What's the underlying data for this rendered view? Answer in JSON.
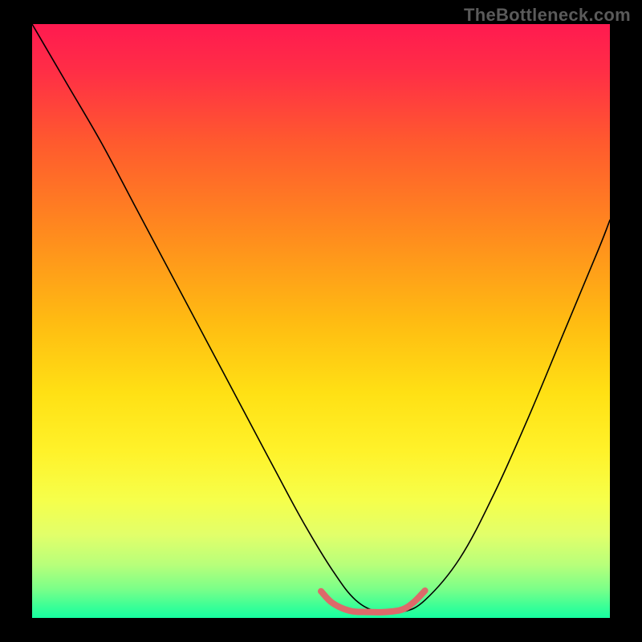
{
  "watermark": "TheBottleneck.com",
  "chart_data": {
    "type": "line",
    "title": "",
    "xlabel": "",
    "ylabel": "",
    "xlim": [
      0,
      100
    ],
    "ylim": [
      0,
      100
    ],
    "grid": false,
    "legend": false,
    "background_gradient": {
      "stops": [
        {
          "offset": 0.0,
          "color": "#ff1a50"
        },
        {
          "offset": 0.08,
          "color": "#ff2e46"
        },
        {
          "offset": 0.2,
          "color": "#ff5a2e"
        },
        {
          "offset": 0.35,
          "color": "#ff8a1e"
        },
        {
          "offset": 0.5,
          "color": "#ffbb12"
        },
        {
          "offset": 0.62,
          "color": "#ffe014"
        },
        {
          "offset": 0.72,
          "color": "#fff22a"
        },
        {
          "offset": 0.8,
          "color": "#f6ff4a"
        },
        {
          "offset": 0.86,
          "color": "#e2ff6a"
        },
        {
          "offset": 0.91,
          "color": "#b8ff7a"
        },
        {
          "offset": 0.95,
          "color": "#7dff88"
        },
        {
          "offset": 0.98,
          "color": "#3cff96"
        },
        {
          "offset": 1.0,
          "color": "#16ffa0"
        }
      ]
    },
    "series": [
      {
        "name": "bottleneck-curve",
        "color": "#000000",
        "width": 1.6,
        "x": [
          0,
          6,
          12,
          18,
          24,
          30,
          36,
          42,
          47,
          52,
          56,
          60,
          64,
          68,
          74,
          80,
          86,
          92,
          98,
          100
        ],
        "y": [
          100,
          90,
          80,
          69,
          58,
          47,
          36,
          25,
          16,
          8,
          3,
          1,
          1,
          3,
          10,
          21,
          34,
          48,
          62,
          67
        ]
      },
      {
        "name": "optimal-band-marker",
        "color": "#dd6a6a",
        "width": 8,
        "x": [
          50,
          52,
          55,
          58,
          61,
          64,
          66,
          68
        ],
        "y": [
          4.5,
          2.5,
          1.2,
          1.0,
          1.0,
          1.4,
          2.6,
          4.6
        ]
      }
    ],
    "annotations": []
  }
}
